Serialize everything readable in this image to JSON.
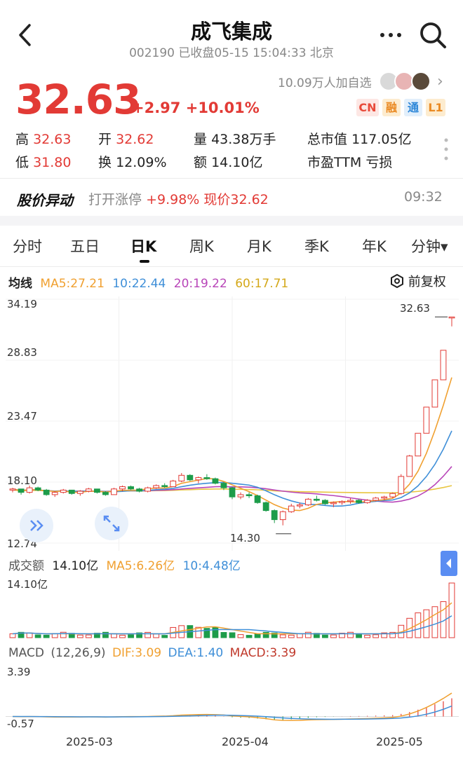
{
  "header": {
    "title": "成飞集成",
    "subtitle": "002190 已收盘05-15 15:04:33 北京"
  },
  "watchlist_text": "10.09万人加自选",
  "quote": {
    "price": "32.63",
    "change": "+2.97 +10.01%",
    "badges": [
      "CN",
      "融",
      "通",
      "L1"
    ]
  },
  "stats": {
    "high_label": "高",
    "high": "32.63",
    "open_label": "开",
    "open": "32.62",
    "volume_label": "量",
    "volume": "43.38万手",
    "mktcap_label": "总市值",
    "mktcap": "117.05亿",
    "low_label": "低",
    "low": "31.80",
    "turnover_label": "换",
    "turnover": "12.09%",
    "amount_label": "额",
    "amount": "14.10亿",
    "pe_label": "市盈TTM",
    "pe": "亏损"
  },
  "alert": {
    "title": "股价异动",
    "text_prefix": "打开涨停",
    "text_value": "+9.98% 现价32.62",
    "time": "09:32"
  },
  "tabs": [
    "分时",
    "五日",
    "日K",
    "周K",
    "月K",
    "季K",
    "年K",
    "分钟▾"
  ],
  "active_tab": "日K",
  "ma": {
    "label": "均线",
    "ma5": "MA5:27.21",
    "ma10": "10:22.44",
    "ma20": "20:19.22",
    "ma60": "60:17.71",
    "adjust_label": "前复权"
  },
  "colors": {
    "up": "#e23a35",
    "down": "#1d9c4a",
    "ma5": "#f0a030",
    "ma10": "#3f8fd8",
    "ma20": "#b845b8",
    "ma60": "#e8c540"
  },
  "kline_axis": [
    "34.19",
    "28.83",
    "23.47",
    "18.10",
    "12.74"
  ],
  "annotations": {
    "max": "32.63",
    "min": "14.30"
  },
  "volume": {
    "label": "成交额",
    "value": "14.10亿",
    "ma5": "MA5:6.26亿",
    "ma10": "10:4.48亿",
    "axis_max": "14.10亿"
  },
  "macd": {
    "label": "MACD",
    "params": "(12,26,9)",
    "dif": "DIF:3.09",
    "dea": "DEA:1.40",
    "macd": "MACD:3.39",
    "axis_max": "3.39",
    "axis_min": "-0.57"
  },
  "dates": [
    "2025-03",
    "2025-04",
    "2025-05"
  ],
  "chart_data": {
    "type": "candlestick",
    "ylim": [
      12.74,
      34.19
    ],
    "candles": [
      [
        17.4,
        17.6,
        17.2,
        17.5
      ],
      [
        17.5,
        17.5,
        17.0,
        17.2
      ],
      [
        17.2,
        17.8,
        17.1,
        17.6
      ],
      [
        17.6,
        17.7,
        17.3,
        17.4
      ],
      [
        17.4,
        17.5,
        16.9,
        17.0
      ],
      [
        17.0,
        17.3,
        16.8,
        17.2
      ],
      [
        17.2,
        17.5,
        17.1,
        17.4
      ],
      [
        17.4,
        17.4,
        17.0,
        17.1
      ],
      [
        17.1,
        17.4,
        16.9,
        17.3
      ],
      [
        17.3,
        17.6,
        17.2,
        17.5
      ],
      [
        17.5,
        17.5,
        17.1,
        17.2
      ],
      [
        17.2,
        17.3,
        16.9,
        17.0
      ],
      [
        17.0,
        17.6,
        17.0,
        17.5
      ],
      [
        17.5,
        17.8,
        17.3,
        17.7
      ],
      [
        17.7,
        17.8,
        17.4,
        17.5
      ],
      [
        17.5,
        17.6,
        17.2,
        17.3
      ],
      [
        17.3,
        17.7,
        17.2,
        17.6
      ],
      [
        17.6,
        17.9,
        17.5,
        17.8
      ],
      [
        17.8,
        18.0,
        17.6,
        17.7
      ],
      [
        17.7,
        18.3,
        17.7,
        18.2
      ],
      [
        18.2,
        18.9,
        18.1,
        18.7
      ],
      [
        18.7,
        18.8,
        18.2,
        18.3
      ],
      [
        18.3,
        18.6,
        18.0,
        18.5
      ],
      [
        18.5,
        18.8,
        18.3,
        18.4
      ],
      [
        18.4,
        18.5,
        17.9,
        18.0
      ],
      [
        18.0,
        18.1,
        17.4,
        17.6
      ],
      [
        17.6,
        17.7,
        16.6,
        16.8
      ],
      [
        16.8,
        17.2,
        16.6,
        17.0
      ],
      [
        17.0,
        17.2,
        16.7,
        16.9
      ],
      [
        16.9,
        17.0,
        16.2,
        16.3
      ],
      [
        16.3,
        16.4,
        15.5,
        15.6
      ],
      [
        15.6,
        15.7,
        14.5,
        14.8
      ],
      [
        14.8,
        15.6,
        14.3,
        15.5
      ],
      [
        15.5,
        16.2,
        15.4,
        16.0
      ],
      [
        16.0,
        16.3,
        15.8,
        16.1
      ],
      [
        16.1,
        16.7,
        16.0,
        16.6
      ],
      [
        16.6,
        16.9,
        16.4,
        16.5
      ],
      [
        16.5,
        16.6,
        16.1,
        16.2
      ],
      [
        16.2,
        16.4,
        15.9,
        16.3
      ],
      [
        16.3,
        16.5,
        16.1,
        16.4
      ],
      [
        16.4,
        16.7,
        16.2,
        16.5
      ],
      [
        16.5,
        16.6,
        16.2,
        16.3
      ],
      [
        16.3,
        16.6,
        16.2,
        16.5
      ],
      [
        16.5,
        16.8,
        16.4,
        16.7
      ],
      [
        16.7,
        16.9,
        16.5,
        16.8
      ],
      [
        16.8,
        17.2,
        16.7,
        17.1
      ],
      [
        17.1,
        18.8,
        17.0,
        18.6
      ],
      [
        18.6,
        20.5,
        18.6,
        20.4
      ],
      [
        20.4,
        22.4,
        20.4,
        22.4
      ],
      [
        22.4,
        24.7,
        22.4,
        24.7
      ],
      [
        24.7,
        27.1,
        24.7,
        27.1
      ],
      [
        27.1,
        29.7,
        27.1,
        29.7
      ],
      [
        32.62,
        32.63,
        31.8,
        32.63
      ]
    ]
  }
}
